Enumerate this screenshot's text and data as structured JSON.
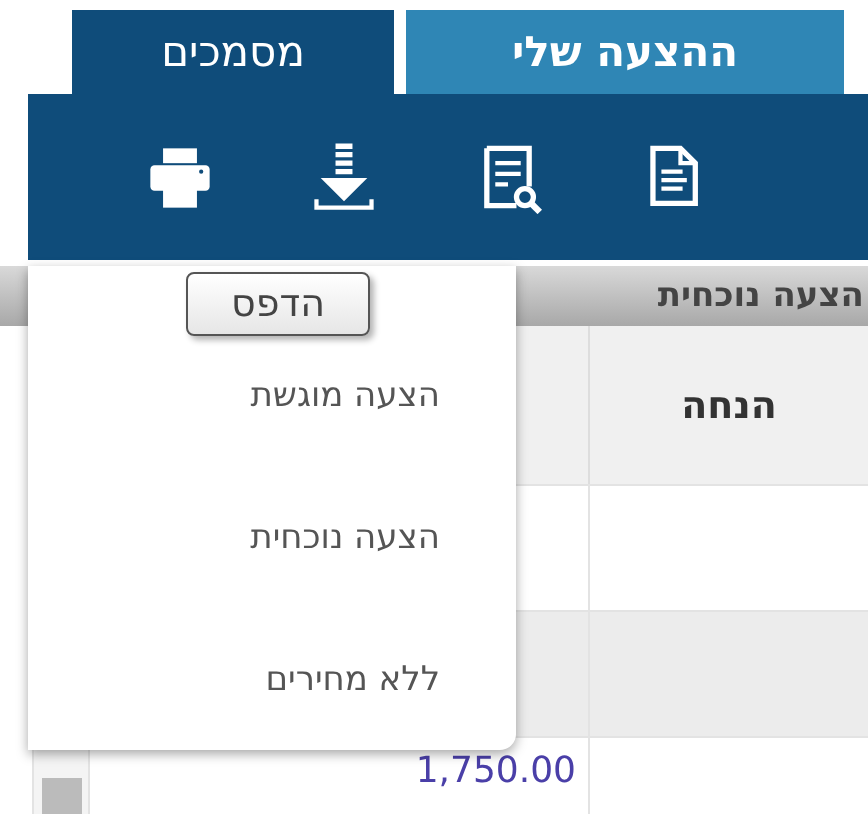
{
  "tabs": [
    {
      "label": "ההצעה שלי",
      "selected": false
    },
    {
      "label": "מסמכים",
      "selected": true
    }
  ],
  "toolbar": {
    "buttons": [
      {
        "kind": "document"
      },
      {
        "kind": "preview"
      },
      {
        "kind": "download"
      },
      {
        "kind": "print"
      }
    ]
  },
  "tooltip": "הדפס",
  "panel": {
    "title": "הצעה נוכחית",
    "columns": [
      "הנחה"
    ],
    "rows": [
      {
        "shaded": false
      },
      {
        "shaded": true
      },
      {
        "shaded": false,
        "amount": "1,750.00"
      }
    ]
  },
  "menu": {
    "items": [
      "הצעה מוגשת",
      "הצעה נוכחית",
      "ללא מחירים"
    ]
  }
}
